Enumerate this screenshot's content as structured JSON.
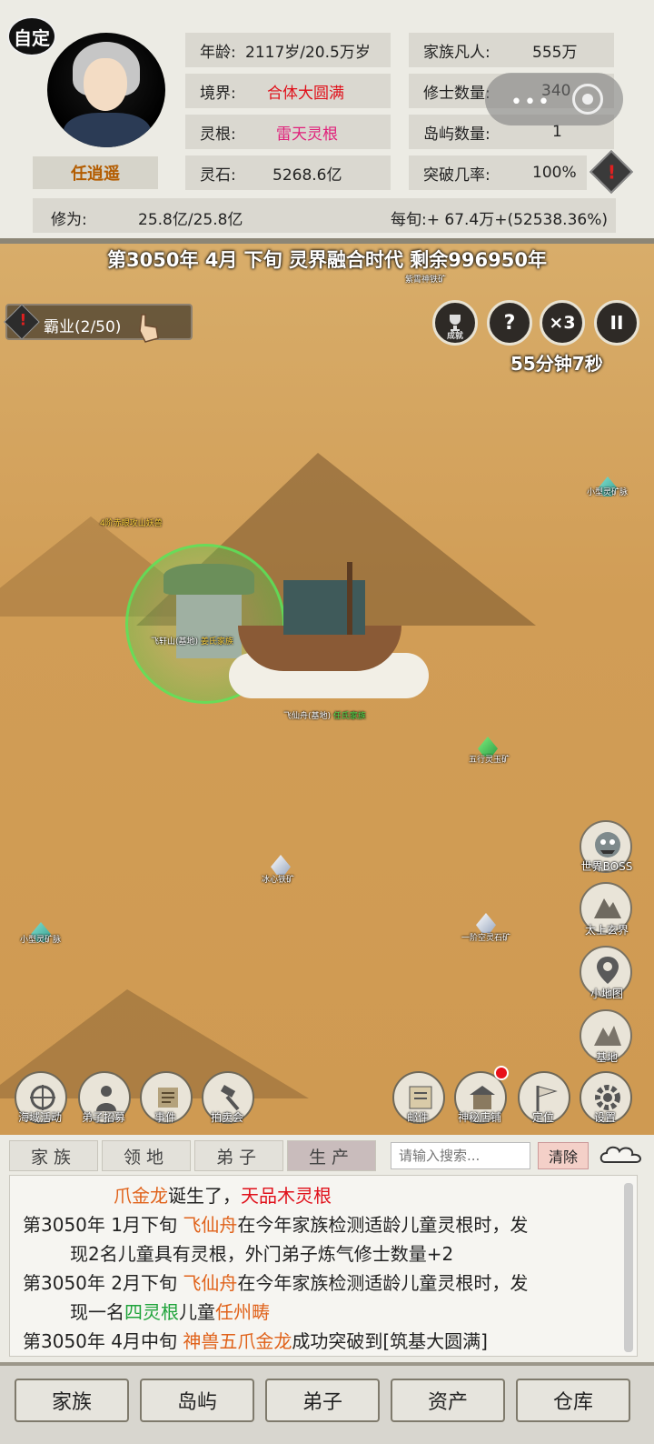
{
  "header": {
    "auto_badge": "自定",
    "player_name": "任逍遥",
    "stats": [
      {
        "key": "年龄:",
        "value": "2117岁/20.5万岁"
      },
      {
        "key": "境界:",
        "value": "合体大圆满"
      },
      {
        "key": "灵根:",
        "value": "雷天灵根"
      },
      {
        "key": "灵石:",
        "value": "5268.6亿"
      }
    ],
    "family": [
      {
        "key": "家族凡人:",
        "value": "555万"
      },
      {
        "key": "修士数量:",
        "value": "340"
      },
      {
        "key": "岛屿数量:",
        "value": "1"
      },
      {
        "key": "突破几率:",
        "value": "100%"
      }
    ],
    "cultivation_label": "修为:",
    "cultivation_value": "25.8亿/25.8亿",
    "income": "每旬:+ 67.4万+(52538.36%)",
    "float_dots": "•••"
  },
  "timebar": "第3050年 4月 下旬  灵界融合时代 剩余996950年",
  "map": {
    "quest_label": "霸业(2/50)",
    "btn_speed": "×3",
    "btn_help": "?",
    "btn_pause": "II",
    "btn_achieve_sub": "成就",
    "timer": "55分钟7秒",
    "labels": {
      "top_mine": "紫霄神铁矿",
      "beast": "4阶赤眼攻山妖兽",
      "small_vein_1": "小型灵矿脉",
      "base_1": "飞轩山(基地)",
      "base_1_family": "姜氏家族",
      "base_2": "飞仙舟(基地)",
      "base_2_family": "任氏家族",
      "five_mine": "五行灵玉矿",
      "ice_mine": "冰心铁矿",
      "small_vein_2": "小型灵矿脉",
      "stone_mine": "一阶空灵石矿"
    },
    "side_buttons": [
      "世界BOSS",
      "太上玄界",
      "小地图",
      "基地"
    ],
    "bottom_left": [
      "海域活动",
      "弟子招募",
      "事件",
      "拍卖会"
    ],
    "bottom_right": [
      "邮件",
      "神秘店铺",
      "定位",
      "设置"
    ]
  },
  "log": {
    "tabs": [
      "家族",
      "领地",
      "弟子",
      "生产"
    ],
    "search_placeholder": "请输入搜索...",
    "clear": "清除",
    "lines": [
      {
        "pre": "",
        "a": "爪金龙",
        "b": "诞生了，",
        "c": "天品木灵根",
        "d": ""
      },
      {
        "pre": "第3050年 1月下旬 ",
        "a": "飞仙舟",
        "b": "在今年家族检测适龄儿童灵根时，发",
        "c": "",
        "d": ""
      },
      {
        "pre": "",
        "a": "",
        "b": "现2名儿童具有灵根，外门弟子炼气修士数量+2",
        "c": "",
        "d": ""
      },
      {
        "pre": "第3050年 2月下旬 ",
        "a": "飞仙舟",
        "b": "在今年家族检测适龄儿童灵根时，发",
        "c": "",
        "d": ""
      },
      {
        "pre": "",
        "a": "",
        "b": "现一名",
        "c": "四灵根",
        "d": "儿童"
      },
      {
        "pre": "第3050年 4月中旬 ",
        "a": "神兽五爪金龙",
        "b": "成功突破到[筑基大圆满]",
        "c": "",
        "d": ""
      }
    ],
    "line5_extra": "任州畴"
  },
  "nav": [
    "家族",
    "岛屿",
    "弟子",
    "资产",
    "仓库"
  ]
}
